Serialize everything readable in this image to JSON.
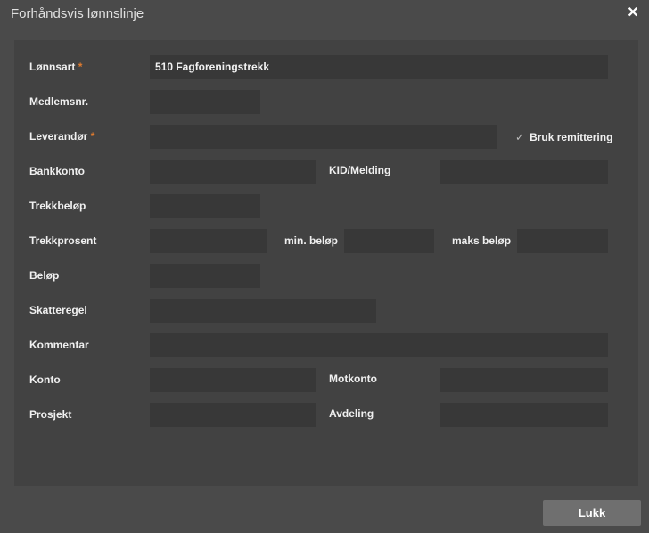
{
  "dialog": {
    "title": "Forhåndsvis lønnslinje",
    "close_icon": "close-icon",
    "close_glyph": "✕"
  },
  "form": {
    "lonnsart_label": "Lønnsart",
    "lonnsart_value": "510 Fagforeningstrekk",
    "required_marker": "*",
    "medlemsnr_label": "Medlemsnr.",
    "leverandor_label": "Leverandør",
    "bruk_remittering_label": "Bruk remittering",
    "bruk_remittering_checked": true,
    "check_glyph": "✓",
    "bankkonto_label": "Bankkonto",
    "kid_label": "KID/Melding",
    "trekkbelop_label": "Trekkbeløp",
    "trekkprosent_label": "Trekkprosent",
    "min_belop_label": "min. beløp",
    "maks_belop_label": "maks beløp",
    "belop_label": "Beløp",
    "skatteregel_label": "Skatteregel",
    "kommentar_label": "Kommentar",
    "konto_label": "Konto",
    "motkonto_label": "Motkonto",
    "prosjekt_label": "Prosjekt",
    "avdeling_label": "Avdeling"
  },
  "footer": {
    "close_button_label": "Lukk"
  }
}
